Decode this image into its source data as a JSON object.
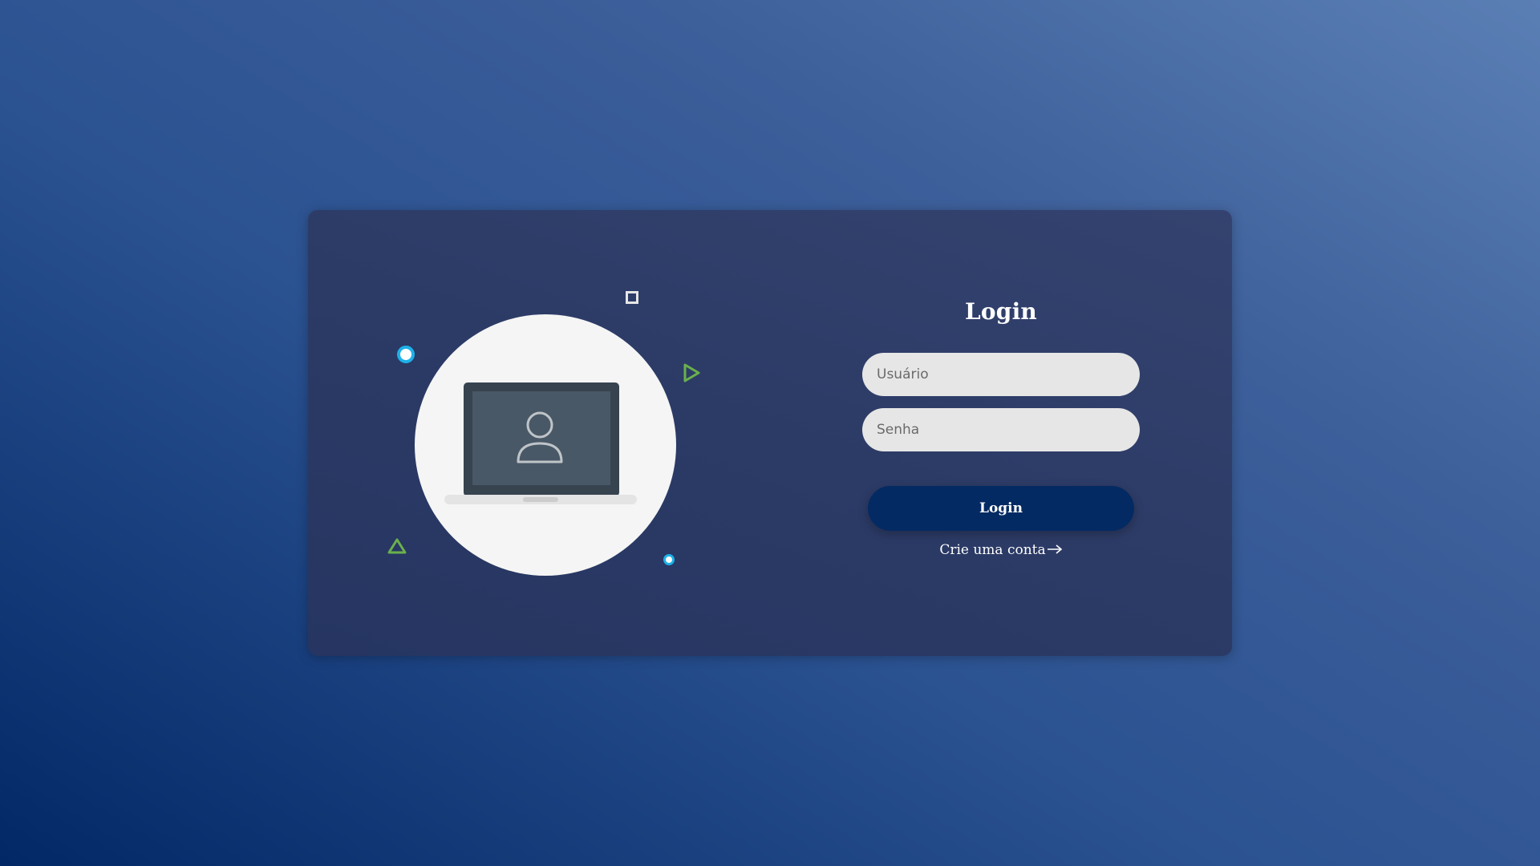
{
  "login": {
    "title": "Login",
    "username_placeholder": "Usuário",
    "password_placeholder": "Senha",
    "submit_label": "Login",
    "signup_link_label": "Crie uma conta"
  },
  "illustration": {
    "icon": "laptop-user-icon",
    "accent_colors": {
      "ring": "#1eb1e8",
      "triangle": "#6ab04c",
      "square": "#e6e6e6"
    }
  },
  "colors": {
    "card": "#2c3b66",
    "button": "#042a63",
    "input_bg": "#e6e6e6"
  }
}
